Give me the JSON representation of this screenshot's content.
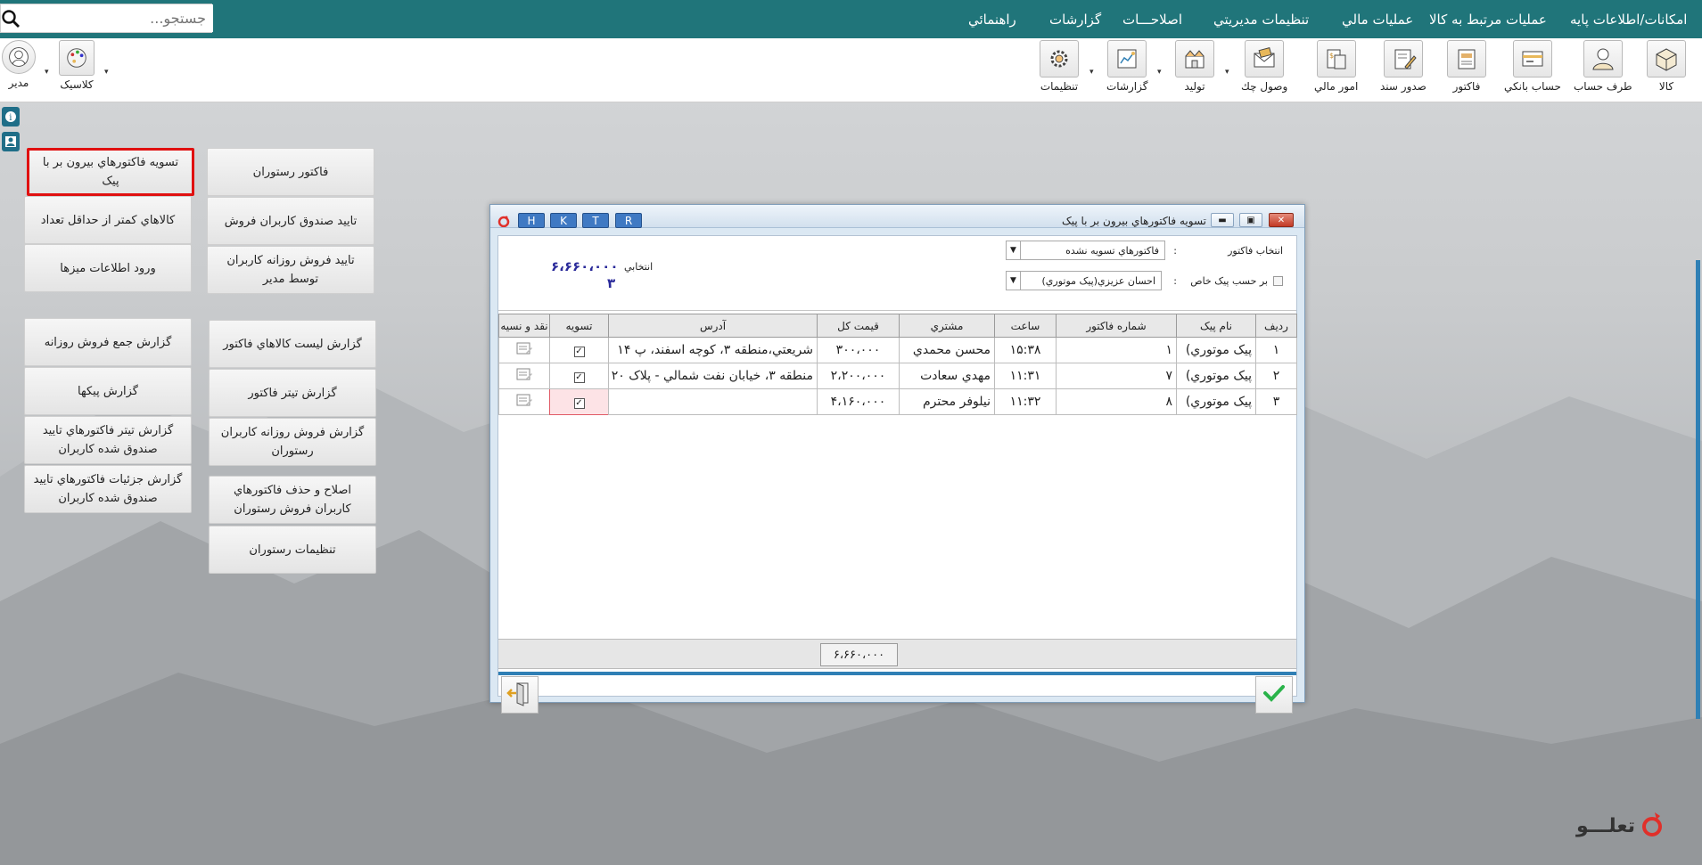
{
  "search": {
    "placeholder": "جستجو..."
  },
  "menu": [
    "امکانات/اطلاعات پايه",
    "عمليات مرتبط به کالا",
    "عمليات مالي",
    "تنظيمات مديريتي",
    "اصلاحـــات",
    "گزارشات",
    "راهنمائي"
  ],
  "toolbar": {
    "items": [
      "کالا",
      "طرف حساب",
      "حساب بانکي",
      "فاکتور",
      "صدور سند",
      "امور مالي",
      "وصول چك",
      "توليد",
      "گزارشات",
      "تنظيمات"
    ],
    "left_items": [
      "کلاسيک",
      "مدير"
    ]
  },
  "sidebar_buttons": {
    "settle_courier": "تسويه فاکتورهاي بيرون بر با پيک",
    "restaurant_invoice": "فاکتور رستوران",
    "low_stock": "کالاهاي کمتر از حداقل تعداد",
    "confirm_cashbox": "تاييد صندوق کاربران فروش",
    "table_info": "ورود اطلاعات ميزها",
    "confirm_daily": "تاييد فروش روزانه کاربران توسط مدير",
    "daily_total_report": "گزارش جمع فروش روزانه",
    "invoice_items_report": "گزارش ليست کالاهاي فاکتور",
    "courier_report": "گزارش پيکها",
    "invoice_header_report": "گزارش تيتر فاکتور",
    "approved_header_report": "گزارش تيتر فاکتورهاي تاييد صندوق شده کاربران",
    "user_daily_report": "گزارش فروش روزانه کاربران رستوران",
    "approved_detail_report": "گزارش جزئيات فاکتورهاي تاييد صندوق شده کاربران",
    "edit_delete": "اصلاح و حذف فاکتورهاي کاربران فروش رستوران",
    "restaurant_settings": "تنظيمات رستوران"
  },
  "dialog": {
    "title": "تسويه فاکتورهاي بيرون بر با پيک",
    "hotkeys": [
      "H",
      "K",
      "T",
      "R"
    ],
    "filter_label": "انتخاب فاکتور",
    "filter_colon": ":",
    "filter_value": "فاکتورهاي تسويه نشده",
    "courier_check_label": "بر حسب پيک خاص",
    "courier_colon": ":",
    "courier_value": "احسان عزيزي(پيک موتوري)",
    "selected_label": "انتخابي",
    "selected_amount": "۶،۶۶۰،۰۰۰",
    "selected_count": "۳",
    "columns": [
      "رديف",
      "نام پيک",
      "شماره فاکتور",
      "ساعت",
      "مشتري",
      "قيمت کل",
      "آدرس",
      "تسويه",
      "نقد و نسيه"
    ],
    "rows": [
      {
        "idx": "۱",
        "courier": "پيک موتوري)",
        "invoice": "۱",
        "time": "۱۵:۳۸",
        "customer": "محسن محمدي",
        "total": "۳۰۰،۰۰۰",
        "address": "شريعتي،منطقه ۳، کوچه اسفند، پ ۱۴",
        "settled": true
      },
      {
        "idx": "۲",
        "courier": "پيک موتوري)",
        "invoice": "۷",
        "time": "۱۱:۳۱",
        "customer": "مهدي سعادت",
        "total": "۲،۲۰۰،۰۰۰",
        "address": "منطقه ۳، خيابان نفت شمالي - پلاک ۲۰",
        "settled": true
      },
      {
        "idx": "۳",
        "courier": "پيک موتوري)",
        "invoice": "۸",
        "time": "۱۱:۳۲",
        "customer": "نيلوفر محترم",
        "total": "۴،۱۶۰،۰۰۰",
        "address": "",
        "settled": true
      }
    ],
    "sum_total": "۶،۶۶۰،۰۰۰"
  },
  "logo_text": "تعلـــو",
  "colors": {
    "topbar": "#20757a",
    "accent_blue": "#2f7fb5",
    "selected_border": "#e01010",
    "confirm_green": "#2ab34a"
  }
}
